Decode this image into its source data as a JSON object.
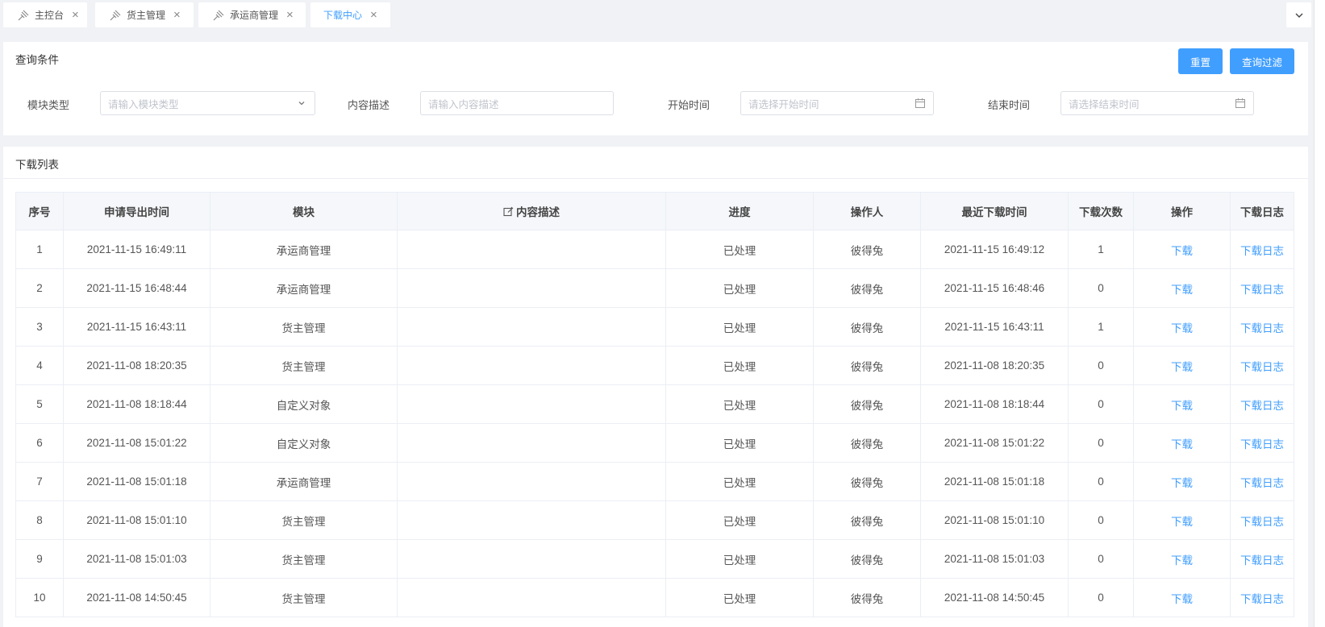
{
  "tabs": [
    {
      "label": "主控台",
      "icon": "pin-icon",
      "active": false
    },
    {
      "label": "货主管理",
      "icon": "pin-icon",
      "active": false
    },
    {
      "label": "承运商管理",
      "icon": "pin-icon",
      "active": false
    },
    {
      "label": "下载中心",
      "active": true
    }
  ],
  "query": {
    "title": "查询条件",
    "reset_label": "重置",
    "search_label": "查询过滤",
    "fields": [
      {
        "label": "模块类型",
        "placeholder": "请输入模块类型",
        "icon": "chevron-down-icon"
      },
      {
        "label": "内容描述",
        "placeholder": "请输入内容描述"
      },
      {
        "label": "开始时间",
        "placeholder": "请选择开始时间",
        "icon": "calendar-icon"
      },
      {
        "label": "结束时间",
        "placeholder": "请选择结束时间",
        "icon": "calendar-icon"
      }
    ]
  },
  "list": {
    "title": "下载列表",
    "columns": [
      "序号",
      "申请导出时间",
      "模块",
      "内容描述",
      "进度",
      "操作人",
      "最近下载时间",
      "下载次数",
      "操作",
      "下载日志"
    ],
    "rows": [
      {
        "no": "1",
        "time": "2021-11-15 16:49:11",
        "module": "承运商管理",
        "desc": "",
        "progress": "已处理",
        "operator": "彼得兔",
        "last": "2021-11-15 16:49:12",
        "count": "1",
        "action": "下载",
        "log": "下载日志"
      },
      {
        "no": "2",
        "time": "2021-11-15 16:48:44",
        "module": "承运商管理",
        "desc": "",
        "progress": "已处理",
        "operator": "彼得兔",
        "last": "2021-11-15 16:48:46",
        "count": "0",
        "action": "下载",
        "log": "下载日志"
      },
      {
        "no": "3",
        "time": "2021-11-15 16:43:11",
        "module": "货主管理",
        "desc": "",
        "progress": "已处理",
        "operator": "彼得兔",
        "last": "2021-11-15 16:43:11",
        "count": "1",
        "action": "下载",
        "log": "下载日志"
      },
      {
        "no": "4",
        "time": "2021-11-08 18:20:35",
        "module": "货主管理",
        "desc": "",
        "progress": "已处理",
        "operator": "彼得兔",
        "last": "2021-11-08 18:20:35",
        "count": "0",
        "action": "下载",
        "log": "下载日志"
      },
      {
        "no": "5",
        "time": "2021-11-08 18:18:44",
        "module": "自定义对象",
        "desc": "",
        "progress": "已处理",
        "operator": "彼得兔",
        "last": "2021-11-08 18:18:44",
        "count": "0",
        "action": "下载",
        "log": "下载日志"
      },
      {
        "no": "6",
        "time": "2021-11-08 15:01:22",
        "module": "自定义对象",
        "desc": "",
        "progress": "已处理",
        "operator": "彼得兔",
        "last": "2021-11-08 15:01:22",
        "count": "0",
        "action": "下载",
        "log": "下载日志"
      },
      {
        "no": "7",
        "time": "2021-11-08 15:01:18",
        "module": "承运商管理",
        "desc": "",
        "progress": "已处理",
        "operator": "彼得兔",
        "last": "2021-11-08 15:01:18",
        "count": "0",
        "action": "下载",
        "log": "下载日志"
      },
      {
        "no": "8",
        "time": "2021-11-08 15:01:10",
        "module": "货主管理",
        "desc": "",
        "progress": "已处理",
        "operator": "彼得兔",
        "last": "2021-11-08 15:01:10",
        "count": "0",
        "action": "下载",
        "log": "下载日志"
      },
      {
        "no": "9",
        "time": "2021-11-08 15:01:03",
        "module": "货主管理",
        "desc": "",
        "progress": "已处理",
        "operator": "彼得兔",
        "last": "2021-11-08 15:01:03",
        "count": "0",
        "action": "下载",
        "log": "下载日志"
      },
      {
        "no": "10",
        "time": "2021-11-08 14:50:45",
        "module": "货主管理",
        "desc": "",
        "progress": "已处理",
        "operator": "彼得兔",
        "last": "2021-11-08 14:50:45",
        "count": "0",
        "action": "下载",
        "log": "下载日志"
      }
    ]
  },
  "colors": {
    "accent": "#409eff",
    "header_bg": "#f5f7fa",
    "border": "#ebeef5"
  }
}
